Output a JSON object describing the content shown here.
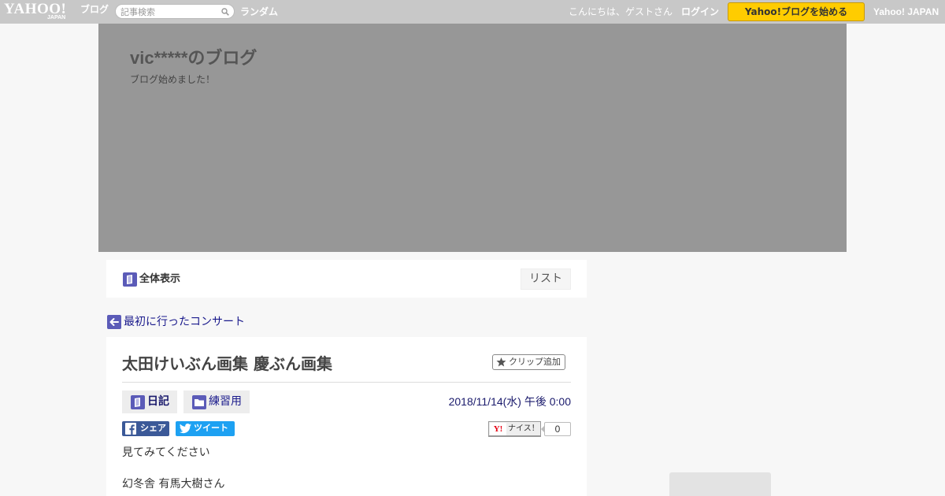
{
  "topbar": {
    "logo_text": "YAHOO!",
    "logo_sub": "JAPAN",
    "service_name": "ブログ",
    "search_placeholder": "記事検索",
    "random_label": "ランダム",
    "greeting": "こんにちは、ゲストさん",
    "login_label": "ログイン",
    "start_blog_label": "Yahoo!ブログを始める",
    "yahoo_japan_label": "Yahoo! JAPAN"
  },
  "header": {
    "blog_title": "vic*****のブログ",
    "blog_description": "ブログ始めました！"
  },
  "nav": {
    "all_label": "全体表示",
    "list_label": "リスト"
  },
  "prev_post": {
    "title": "最初に行ったコンサート"
  },
  "article": {
    "title": "太田けいぶん画集 慶ぶん画集",
    "clip_label": "クリップ追加",
    "categories": [
      {
        "label": "日記",
        "icon": "book-icon"
      },
      {
        "label": "練習用",
        "icon": "folder-icon"
      }
    ],
    "date": "2018/11/14(水) 午後 0:00",
    "share": {
      "facebook_label": "シェア",
      "twitter_label": "ツイート"
    },
    "nice": {
      "label": "ナイス！",
      "logo": "Y!",
      "count": "0"
    },
    "body": [
      "見てみてください",
      "幻冬舎 有馬大樹さん"
    ]
  },
  "colors": {
    "topbar_bg": "#c8c8c8",
    "header_bg": "#979797",
    "start_button": "#ffcc00",
    "link_blue": "#1a1a8c",
    "icon_purple": "#5b5bb8",
    "facebook": "#3b5998",
    "twitter": "#1da1f2"
  }
}
